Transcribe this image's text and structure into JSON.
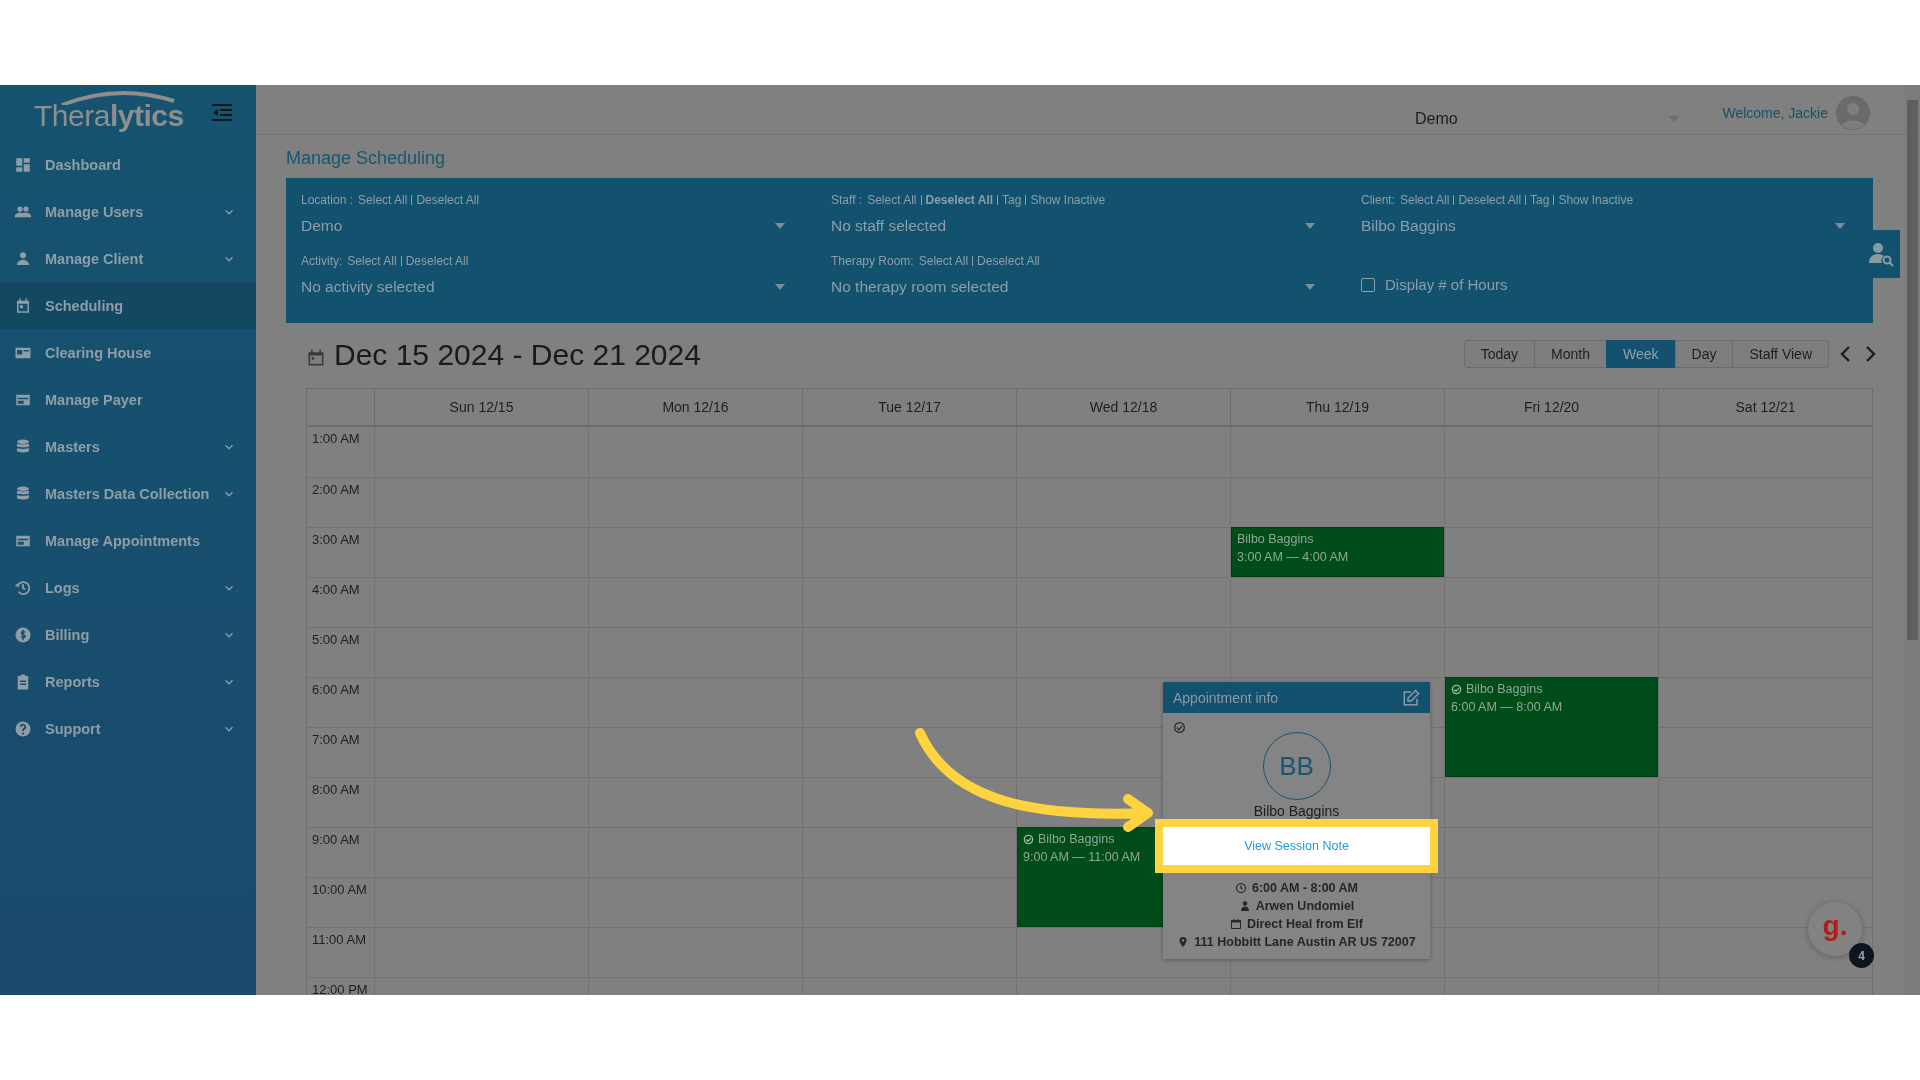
{
  "sidebar": {
    "logo": {
      "light": "Thera",
      "bold": "lytics"
    },
    "items": [
      {
        "label": "Dashboard",
        "expandable": false,
        "selected": false
      },
      {
        "label": "Manage Users",
        "expandable": true,
        "selected": false
      },
      {
        "label": "Manage Client",
        "expandable": true,
        "selected": false
      },
      {
        "label": "Scheduling",
        "expandable": false,
        "selected": true
      },
      {
        "label": "Clearing House",
        "expandable": false,
        "selected": false
      },
      {
        "label": "Manage Payer",
        "expandable": false,
        "selected": false
      },
      {
        "label": "Masters",
        "expandable": true,
        "selected": false
      },
      {
        "label": "Masters Data Collection",
        "expandable": true,
        "selected": false
      },
      {
        "label": "Manage Appointments",
        "expandable": false,
        "selected": false
      },
      {
        "label": "Logs",
        "expandable": true,
        "selected": false
      },
      {
        "label": "Billing",
        "expandable": true,
        "selected": false
      },
      {
        "label": "Reports",
        "expandable": true,
        "selected": false
      },
      {
        "label": "Support",
        "expandable": true,
        "selected": false
      }
    ]
  },
  "header": {
    "location": "Demo",
    "welcome": "Welcome, Jackie"
  },
  "page_title": "Manage Scheduling",
  "filters": [
    {
      "label": "Location :",
      "links": [
        {
          "text": "Select All",
          "bold": false
        },
        {
          "text": "Deselect All",
          "bold": false
        }
      ],
      "value": "Demo"
    },
    {
      "label": "Staff :",
      "links": [
        {
          "text": "Select All",
          "bold": false
        },
        {
          "text": "Deselect All",
          "bold": true
        },
        {
          "text": "Tag",
          "bold": false
        },
        {
          "text": "Show Inactive",
          "bold": false
        }
      ],
      "value": "No staff selected"
    },
    {
      "label": "Client:",
      "links": [
        {
          "text": "Select All",
          "bold": false
        },
        {
          "text": "Deselect All",
          "bold": false
        },
        {
          "text": "Tag",
          "bold": false
        },
        {
          "text": "Show Inactive",
          "bold": false
        }
      ],
      "value": "Bilbo Baggins"
    },
    {
      "label": "Activity:",
      "links": [
        {
          "text": "Select All",
          "bold": false
        },
        {
          "text": "Deselect All",
          "bold": false
        }
      ],
      "value": "No activity selected"
    },
    {
      "label": "Therapy Room:",
      "links": [
        {
          "text": "Select All",
          "bold": false
        },
        {
          "text": "Deselect All",
          "bold": false
        }
      ],
      "value": "No therapy room selected"
    }
  ],
  "display_hours": {
    "label": "Display # of Hours",
    "checked": false
  },
  "calendar": {
    "range": "Dec 15 2024 - Dec 21 2024",
    "views": [
      {
        "label": "Today",
        "selected": false
      },
      {
        "label": "Month",
        "selected": false
      },
      {
        "label": "Week",
        "selected": true
      },
      {
        "label": "Day",
        "selected": false
      },
      {
        "label": "Staff View",
        "selected": false
      }
    ],
    "times": [
      "1:00 AM",
      "2:00 AM",
      "3:00 AM",
      "4:00 AM",
      "5:00 AM",
      "6:00 AM",
      "7:00 AM",
      "8:00 AM",
      "9:00 AM",
      "10:00 AM",
      "11:00 AM",
      "12:00 PM"
    ],
    "days": [
      {
        "label": "Sun 12/15"
      },
      {
        "label": "Mon 12/16"
      },
      {
        "label": "Tue 12/17"
      },
      {
        "label": "Wed 12/18",
        "events": [
          {
            "title": "Bilbo Baggins",
            "time": "9:00 AM — 11:00 AM",
            "confirmed": true
          }
        ]
      },
      {
        "label": "Thu 12/19",
        "events": [
          {
            "title": "Bilbo Baggins",
            "time": "3:00 AM — 4:00 AM",
            "confirmed": false
          }
        ]
      },
      {
        "label": "Fri 12/20",
        "events": [
          {
            "title": "Bilbo Baggins",
            "time": "6:00 AM — 8:00 AM",
            "confirmed": true
          }
        ]
      },
      {
        "label": "Sat 12/21"
      }
    ]
  },
  "popup": {
    "title": "Appointment info",
    "confirmed": true,
    "initials": "BB",
    "client": "Bilbo Baggins",
    "link": "View Session Note",
    "details": [
      {
        "kind": "time",
        "text": "6:00 AM - 8:00 AM"
      },
      {
        "kind": "person",
        "text": "Arwen Undomiel"
      },
      {
        "kind": "calendar",
        "text": "Direct Heal from Elf"
      },
      {
        "kind": "location",
        "text": "111 Hobbitt Lane Austin AR US 72007"
      }
    ]
  },
  "chat_bubble": {
    "letter": "g.",
    "badge": "4"
  }
}
